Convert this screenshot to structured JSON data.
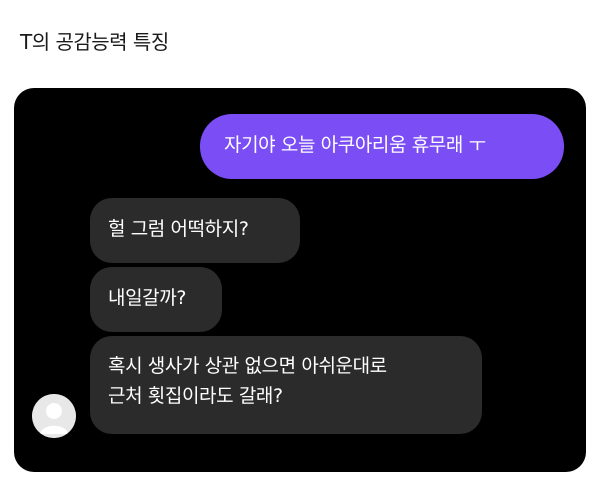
{
  "post": {
    "title": "T의 공감능력 특징"
  },
  "chat": {
    "sent": {
      "text": "자기야 오늘 아쿠아리움 휴무래 ㅜ"
    },
    "received": [
      {
        "lines": [
          "헐 그럼 어떡하지?"
        ]
      },
      {
        "lines": [
          "내일갈까?"
        ]
      },
      {
        "lines": [
          "혹시 생사가 상관 없으면 아쉬운대로",
          "근처 횟집이라도 갈래?"
        ]
      }
    ],
    "avatar_icon": "default-user-avatar-icon"
  },
  "colors": {
    "page_background": "#ffffff",
    "chat_background": "#000000",
    "sent_bubble": "#7b4df5",
    "received_bubble": "#2b2b2b",
    "bubble_text": "#ffffff"
  }
}
